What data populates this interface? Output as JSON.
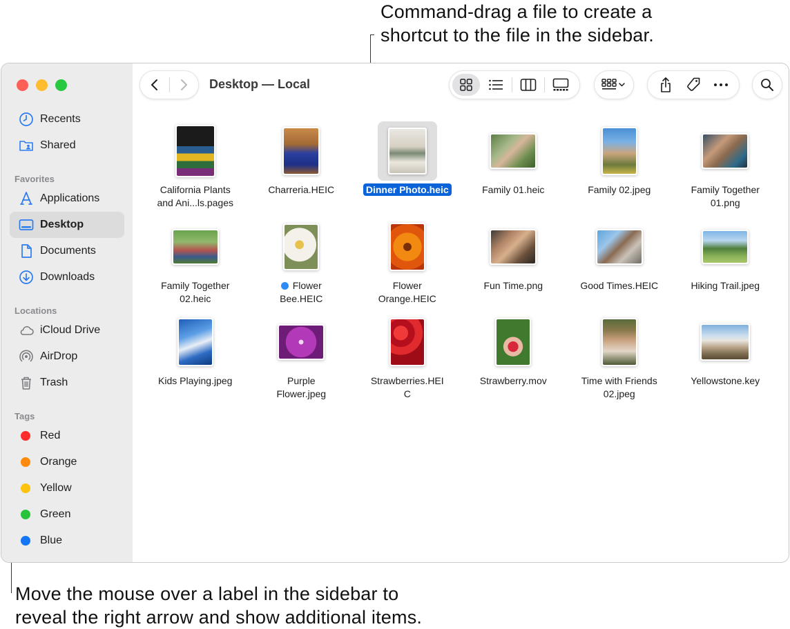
{
  "callouts": {
    "top_line1": "Command-drag a file to create a",
    "top_line2": "shortcut to the file in the sidebar.",
    "bottom_line1": "Move the mouse over a label in the sidebar to",
    "bottom_line2": "reveal the right arrow and show additional items."
  },
  "window": {
    "title": "Desktop — Local"
  },
  "toolbar": {
    "icons": [
      "back-arrow-icon",
      "forward-arrow-icon",
      "icon-view-icon",
      "list-view-icon",
      "column-view-icon",
      "gallery-view-icon",
      "group-icon",
      "share-icon",
      "tag-icon",
      "more-icon",
      "search-icon"
    ]
  },
  "sidebar": {
    "top_items": [
      {
        "label": "Recents",
        "icon": "clock-icon"
      },
      {
        "label": "Shared",
        "icon": "shared-folder-icon"
      }
    ],
    "favorites_header": "Favorites",
    "favorites": [
      {
        "label": "Applications",
        "icon": "applications-icon"
      },
      {
        "label": "Desktop",
        "icon": "desktop-icon"
      },
      {
        "label": "Documents",
        "icon": "document-icon"
      },
      {
        "label": "Downloads",
        "icon": "download-icon"
      }
    ],
    "locations_header": "Locations",
    "locations": [
      {
        "label": "iCloud Drive",
        "icon": "cloud-icon"
      },
      {
        "label": "AirDrop",
        "icon": "airdrop-icon"
      },
      {
        "label": "Trash",
        "icon": "trash-icon"
      }
    ],
    "tags_header": "Tags",
    "tags": [
      {
        "label": "Red",
        "color": "#fe2c2c"
      },
      {
        "label": "Orange",
        "color": "#fd8a0c"
      },
      {
        "label": "Yellow",
        "color": "#fdc30f"
      },
      {
        "label": "Green",
        "color": "#28c23b"
      },
      {
        "label": "Blue",
        "color": "#1476f5"
      }
    ]
  },
  "files": [
    {
      "l1": "California Plants",
      "l2": "and Ani...ls.pages"
    },
    {
      "l1": "Charreria.HEIC",
      "l2": ""
    },
    {
      "l1": "Dinner Photo.heic",
      "l2": "",
      "selected": true
    },
    {
      "l1": "Family 01.heic",
      "l2": ""
    },
    {
      "l1": "Family 02.jpeg",
      "l2": ""
    },
    {
      "l1": "Family Together",
      "l2": "01.png"
    },
    {
      "l1": "Family Together",
      "l2": "02.heic"
    },
    {
      "l1": "Flower",
      "l2": "Bee.HEIC",
      "tag": "blue"
    },
    {
      "l1": "Flower",
      "l2": "Orange.HEIC"
    },
    {
      "l1": "Fun Time.png",
      "l2": ""
    },
    {
      "l1": "Good Times.HEIC",
      "l2": ""
    },
    {
      "l1": "Hiking Trail.jpeg",
      "l2": ""
    },
    {
      "l1": "Kids Playing.jpeg",
      "l2": ""
    },
    {
      "l1": "Purple",
      "l2": "Flower.jpeg"
    },
    {
      "l1": "Strawberries.HEI",
      "l2": "C"
    },
    {
      "l1": "Strawberry.mov",
      "l2": ""
    },
    {
      "l1": "Time with Friends",
      "l2": "02.jpeg"
    },
    {
      "l1": "Yellowstone.key",
      "l2": ""
    }
  ]
}
